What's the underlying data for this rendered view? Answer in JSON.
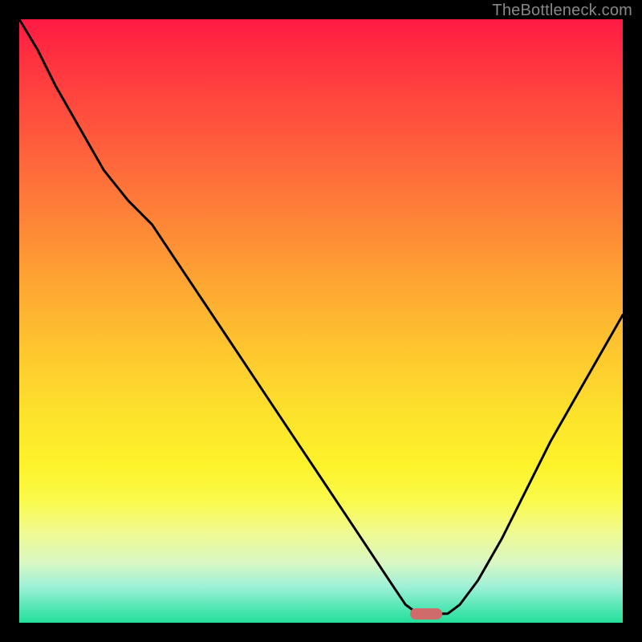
{
  "watermark": "TheBottleneck.com",
  "marker": {
    "x_frac": 0.674,
    "y_frac": 0.985,
    "color": "#cf6b6b"
  },
  "chart_data": {
    "type": "line",
    "title": "",
    "xlabel": "",
    "ylabel": "",
    "xlim": [
      0,
      1
    ],
    "ylim": [
      0,
      1
    ],
    "background_gradient": {
      "top": "#ff1a44",
      "mid": "#fec42f",
      "bottom": "#22df9a"
    },
    "series": [
      {
        "name": "curve",
        "x": [
          0.0,
          0.03,
          0.06,
          0.1,
          0.14,
          0.18,
          0.22,
          0.26,
          0.3,
          0.34,
          0.38,
          0.42,
          0.46,
          0.5,
          0.54,
          0.58,
          0.62,
          0.64,
          0.66,
          0.69,
          0.71,
          0.73,
          0.76,
          0.8,
          0.84,
          0.88,
          0.92,
          0.96,
          1.0
        ],
        "y": [
          1.0,
          0.95,
          0.89,
          0.82,
          0.75,
          0.7,
          0.66,
          0.6,
          0.54,
          0.48,
          0.42,
          0.36,
          0.3,
          0.24,
          0.18,
          0.12,
          0.06,
          0.03,
          0.015,
          0.015,
          0.015,
          0.03,
          0.07,
          0.14,
          0.22,
          0.3,
          0.37,
          0.44,
          0.51
        ]
      }
    ],
    "marker_point": {
      "x": 0.674,
      "y": 0.015
    }
  }
}
